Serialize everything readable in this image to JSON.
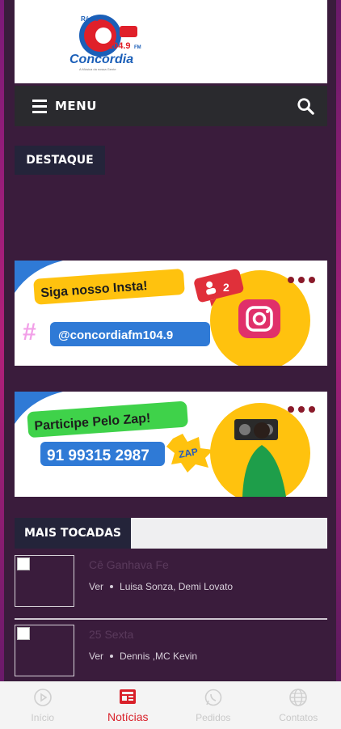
{
  "header": {
    "logo_alt": "Rádio Concórdia 104.9 FM"
  },
  "menu": {
    "label": "MENU"
  },
  "destaque": {
    "label": "DESTAQUE"
  },
  "banners": {
    "insta": {
      "title": "Siga nosso Insta!",
      "handle": "@concordiafm104.9",
      "badge": "2"
    },
    "zap": {
      "title": "Participe Pelo Zap!",
      "phone": "91 99315 2987",
      "sticker": "ZAP"
    }
  },
  "mais_tocadas": {
    "label": "MAIS TOCADAS",
    "items": [
      {
        "title": "Cê Ganhava Fe",
        "action": "Ver",
        "artist": "Luisa Sonza, Demi Lovato"
      },
      {
        "title": "25 Sexta",
        "action": "Ver",
        "artist": "Dennis ,MC Kevin"
      }
    ]
  },
  "tabbar": {
    "tabs": [
      {
        "label": "Início"
      },
      {
        "label": "Notícias"
      },
      {
        "label": "Pedidos"
      },
      {
        "label": "Contatos"
      }
    ]
  },
  "colors": {
    "background": "#3a1c3c",
    "accent_red": "#d9212a",
    "tag_bg": "#24243a"
  }
}
